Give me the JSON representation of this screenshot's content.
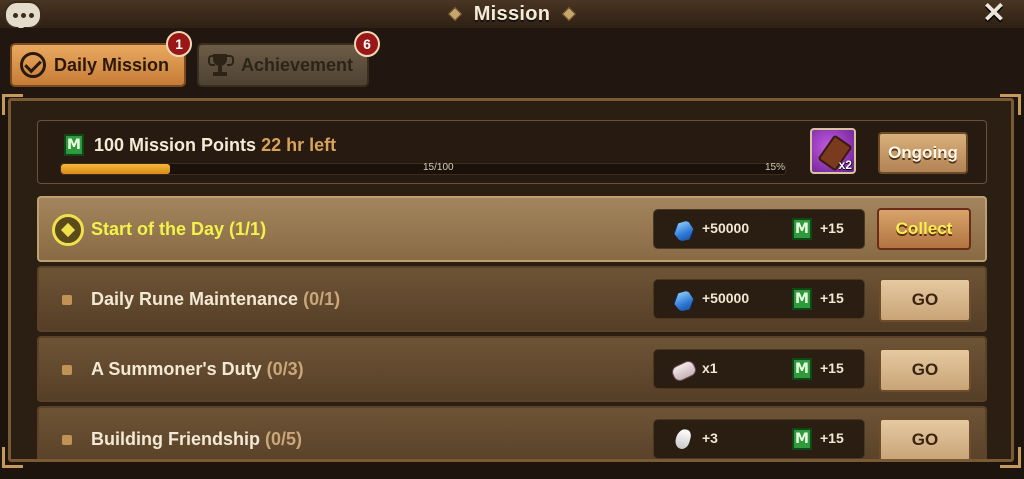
{
  "header": {
    "title": "Mission",
    "close_glyph": "✕"
  },
  "tabs": [
    {
      "label": "Daily Mission",
      "badge": "1",
      "icon": "checkmark-circle-icon",
      "selected": true
    },
    {
      "label": "Achievement",
      "badge": "6",
      "icon": "trophy-icon",
      "selected": false
    }
  ],
  "points": {
    "label": "100 Mission Points",
    "time_left": "22 hr left",
    "count": "15/100",
    "percent": "15%",
    "progress_fraction": 0.15,
    "reward_qty": "x2",
    "button": "Ongoing"
  },
  "missions": [
    {
      "title": "Start of the Day",
      "progress": "(1/1)",
      "reward1_icon": "crystal-icon",
      "reward1": "+50000",
      "reward2": "+15",
      "button": "Collect",
      "active": true
    },
    {
      "title": "Daily Rune Maintenance",
      "progress": "(0/1)",
      "reward1_icon": "crystal-icon",
      "reward1": "+50000",
      "reward2": "+15",
      "button": "GO",
      "active": false
    },
    {
      "title": "A Summoner's Duty",
      "progress": "(0/3)",
      "reward1_icon": "scroll-icon",
      "reward1": "x1",
      "reward2": "+15",
      "button": "GO",
      "active": false
    },
    {
      "title": "Building Friendship",
      "progress": "(0/5)",
      "reward1_icon": "flame-icon",
      "reward1": "+3",
      "reward2": "+15",
      "button": "GO",
      "active": false
    }
  ],
  "colors": {
    "accent_yellow": "#f3f24b",
    "progress_orange": "#f7b73a",
    "badge_red": "#9a1717"
  }
}
